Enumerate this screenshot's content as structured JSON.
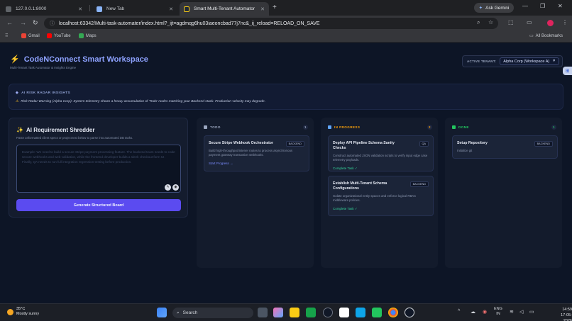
{
  "browser": {
    "tabs": [
      {
        "title": "127.0.0.1:8000"
      },
      {
        "title": "New Tab"
      },
      {
        "title": "Smart Multi-Tenant Automator"
      }
    ],
    "gemini_label": "Ask Gemini",
    "url": "localhost:63342/Multi-task-automater/index.html?_ijt=agdmqg6hu03iaeoncbad77j7nc&_ij_reload=RELOAD_ON_SAVE",
    "bookmarks": [
      {
        "label": "Gmail",
        "color": "#ea4335"
      },
      {
        "label": "YouTube",
        "color": "#ff0000"
      },
      {
        "label": "Maps",
        "color": "#34a853"
      }
    ],
    "all_bookmarks_label": "All Bookmarks"
  },
  "header": {
    "title": "CodeNConnect Smart Workspace",
    "subtitle": "Multi-Tenant Task Automator & Insights Engine",
    "tenant_label": "ACTIVE TENANT:",
    "tenant_value": "Alpha Corp (Workspace A)"
  },
  "radar": {
    "title": "AI RISK RADAR INSIGHTS",
    "message": "Risk Radar Warning (Alpha Corp): System telemetry shows a heavy accumulation of 'Todo' nodes matching your Backend stack. Production velocity may degrade."
  },
  "shredder": {
    "title": "AI Requirement Shredder",
    "description": "Paste unformatted client specs or project text below to parse into automated DB tasks.",
    "placeholder": "Example: We need to build a secure Stripe payment processing feature. The backend team needs to code secure webhooks and web validation, while the frontend developer builds a sleek checkout form UI. Finally, QA needs to run full integration regression testing before production.",
    "button_label": "Generate Structured Board"
  },
  "board": {
    "columns": [
      {
        "name": "TODO",
        "count": "1",
        "color": "#9aa6bf",
        "cards": [
          {
            "title": "Secure Stripe Webhook Orchestrator",
            "badge": "BACKEND",
            "description": "Build high-throughput listener routes to process asynchronous payment gateway transaction webhooks.",
            "action": "Start Progress →"
          }
        ]
      },
      {
        "name": "IN PROGRESS",
        "count": "2",
        "color": "#f59e0b",
        "cards": [
          {
            "title": "Deploy API Pipeline Schema Sanity Checks",
            "badge": "QA",
            "description": "Construct automated JSON validation scripts to verify input edge case telemetry payloads.",
            "action": "Complete Task ✓"
          },
          {
            "title": "Establish Multi-Tenant Schema Configurations",
            "badge": "BACKEND",
            "description": "Isolate organizational entity spaces and enforce logical RBAC middleware policies.",
            "action": "Complete Task ✓"
          }
        ]
      },
      {
        "name": "DONE",
        "count": "1",
        "color": "#22c55e",
        "cards": [
          {
            "title": "Setup Repository",
            "badge": "BACKEND",
            "description": "Initialize git",
            "action": ""
          }
        ]
      }
    ]
  },
  "taskbar": {
    "temperature": "35°C",
    "weather": "Mostly sunny",
    "search_label": "Search",
    "language": "ENG",
    "region": "IN",
    "time": "14:59",
    "date": "17-05-2026"
  }
}
